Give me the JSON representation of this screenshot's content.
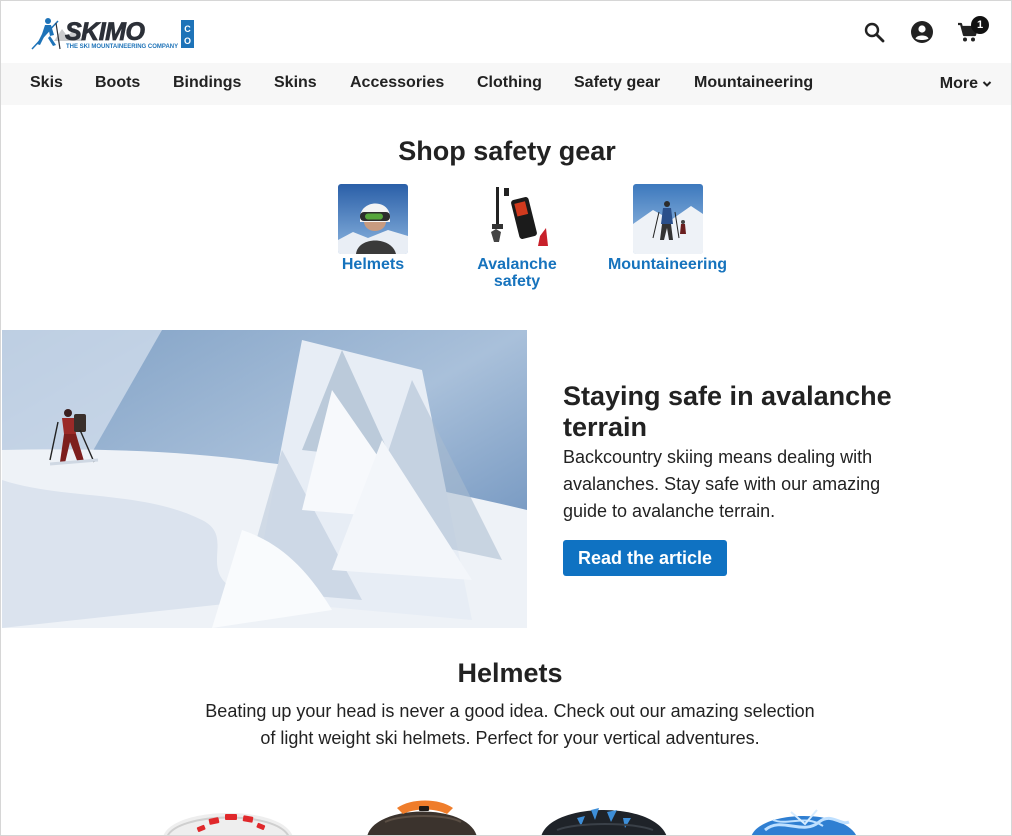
{
  "header": {
    "logo_text": "SKIMO",
    "logo_suffix": "CO",
    "logo_tagline": "THE SKI MOUNTAINEERING COMPANY",
    "cart_count": "1",
    "icons": [
      "search-icon",
      "account-icon",
      "cart-icon"
    ]
  },
  "nav": {
    "items": [
      "Skis",
      "Boots",
      "Bindings",
      "Skins",
      "Accessories",
      "Clothing",
      "Safety gear",
      "Mountaineering"
    ],
    "more_label": "More"
  },
  "shop": {
    "title": "Shop safety gear",
    "categories": [
      {
        "label": "Helmets"
      },
      {
        "label": "Avalanche safety"
      },
      {
        "label": "Mountaineering"
      }
    ]
  },
  "hero": {
    "title": "Staying safe in avalanche terrain",
    "text": "Backcountry skiing means dealing with avalanches. Stay safe with our amazing guide to avalanche terrain.",
    "button_label": "Read the article"
  },
  "helmets": {
    "title": "Helmets",
    "text": "Beating up your head is never a good idea. Check out our amazing selection of light weight ski helmets. Perfect for your vertical adventures."
  },
  "colors": {
    "accent": "#0f72c2",
    "link": "#1673bd",
    "nav_bg": "#f7f7f7",
    "logo_dark": "#2c3038",
    "logo_blue": "#1e73b8"
  }
}
